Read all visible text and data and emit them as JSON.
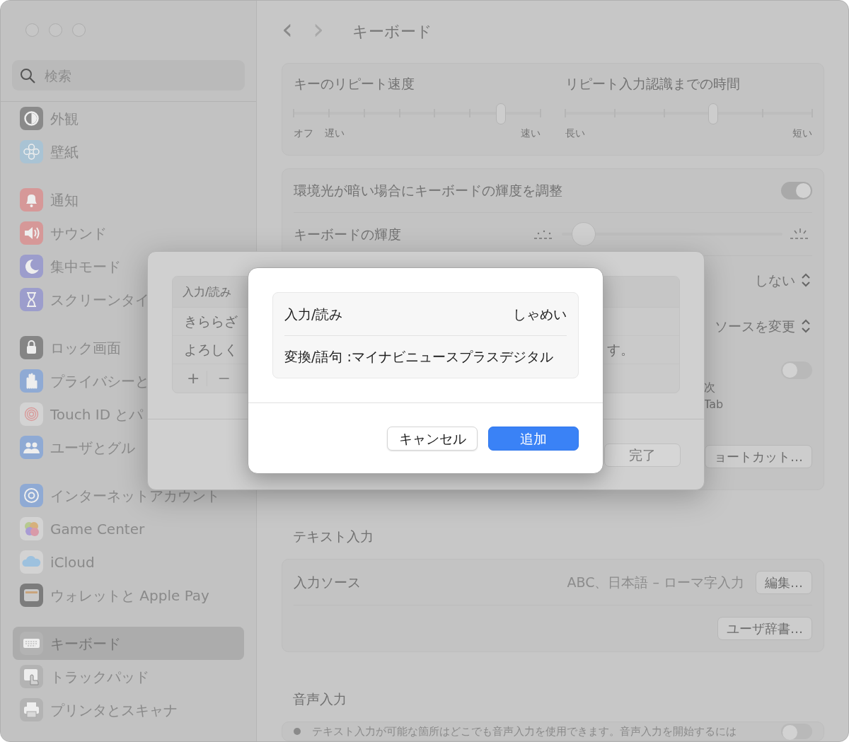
{
  "sidebar": {
    "search": {
      "placeholder": "検索"
    },
    "groups": [
      [
        {
          "label": "外観",
          "color": "#8a8a8a",
          "selected": false
        },
        {
          "label": "壁紙",
          "color": "#a9c3d4",
          "selected": false
        }
      ],
      [
        {
          "label": "通知",
          "color": "#d69898",
          "selected": false
        },
        {
          "label": "サウンド",
          "color": "#d69898",
          "selected": false
        },
        {
          "label": "集中モード",
          "color": "#9c9dcc",
          "selected": false
        },
        {
          "label": "スクリーンタイ",
          "color": "#9c9dcc",
          "selected": false
        }
      ],
      [
        {
          "label": "ロック画面",
          "color": "#858585",
          "selected": false
        },
        {
          "label": "プライバシーと",
          "color": "#8faad4",
          "selected": false
        },
        {
          "label": "Touch ID とパ",
          "color": "#d3d3d3",
          "selected": false
        },
        {
          "label": "ユーザとグル",
          "color": "#8faad4",
          "selected": false
        }
      ],
      [
        {
          "label": "インターネットアカウント",
          "color": "#8faad4",
          "selected": false
        },
        {
          "label": "Game Center",
          "color": "#d3d3d3",
          "selected": false
        },
        {
          "label": "iCloud",
          "color": "#d3d3d3",
          "selected": false
        },
        {
          "label": "ウォレットと Apple Pay",
          "color": "#7c7c7c",
          "selected": false
        }
      ],
      [
        {
          "label": "キーボード",
          "color": "#b3b3b3",
          "selected": true
        },
        {
          "label": "トラックパッド",
          "color": "#b3b3b3",
          "selected": false
        },
        {
          "label": "プリンタとスキャナ",
          "color": "#b3b3b3",
          "selected": false
        }
      ]
    ]
  },
  "header": {
    "back": "‹",
    "forward": "›",
    "title": "キーボード"
  },
  "repeat_card": {
    "sliders": [
      {
        "title": "キーのリピート速度",
        "level": 0.84,
        "labels_left": [
          "オフ",
          "遅い"
        ],
        "label_right": "速い"
      },
      {
        "title": "リピート入力認識までの時間",
        "level": 0.6,
        "labels_left": [
          "長い"
        ],
        "label_right": "短い"
      }
    ]
  },
  "keyboard_card": {
    "rows": [
      {
        "kind": "toggle",
        "label": "環境光が暗い場合にキーボードの輝度を調整",
        "on": true
      },
      {
        "kind": "slider",
        "label": "キーボードの輝度",
        "level": 0.1
      },
      {
        "kind": "popup",
        "value": "しない"
      },
      {
        "kind": "popup",
        "value": "ソースを変更"
      },
      {
        "kind": "toggle",
        "on": false,
        "notes": [
          "次",
          "Tab"
        ]
      },
      {
        "kind": "button",
        "button": "ョートカット…"
      }
    ]
  },
  "text_input": {
    "title": "テキスト入力",
    "rows": [
      {
        "kind": "value_button",
        "label": "入力ソース",
        "value": "ABC、日本語 – ローマ字入力",
        "button": "編集…"
      },
      {
        "kind": "button",
        "button": "ユーザ辞書…"
      }
    ]
  },
  "voice_input": {
    "title": "音声入力",
    "rows": [
      {
        "text": "テキスト入力が可能な箇所はどこでも音声入力を使用できます。音声入力を開始するには",
        "on": false
      }
    ]
  },
  "sheet": {
    "columns": [
      "入力/読み"
    ],
    "rows": [
      [
        "きららざ"
      ],
      [
        "よろしく",
        "す。"
      ]
    ],
    "footer_buttons": [
      "+",
      "−"
    ],
    "done": "完了"
  },
  "dialog": {
    "fields": [
      {
        "label": "入力/読み",
        "value": "しゃめい"
      },
      {
        "label": "変換/語句",
        "value": ":マイナビニュースプラスデジタル"
      }
    ],
    "buttons": [
      {
        "label": "キャンセル",
        "kind": "default"
      },
      {
        "label": "追加",
        "kind": "primary"
      }
    ]
  }
}
